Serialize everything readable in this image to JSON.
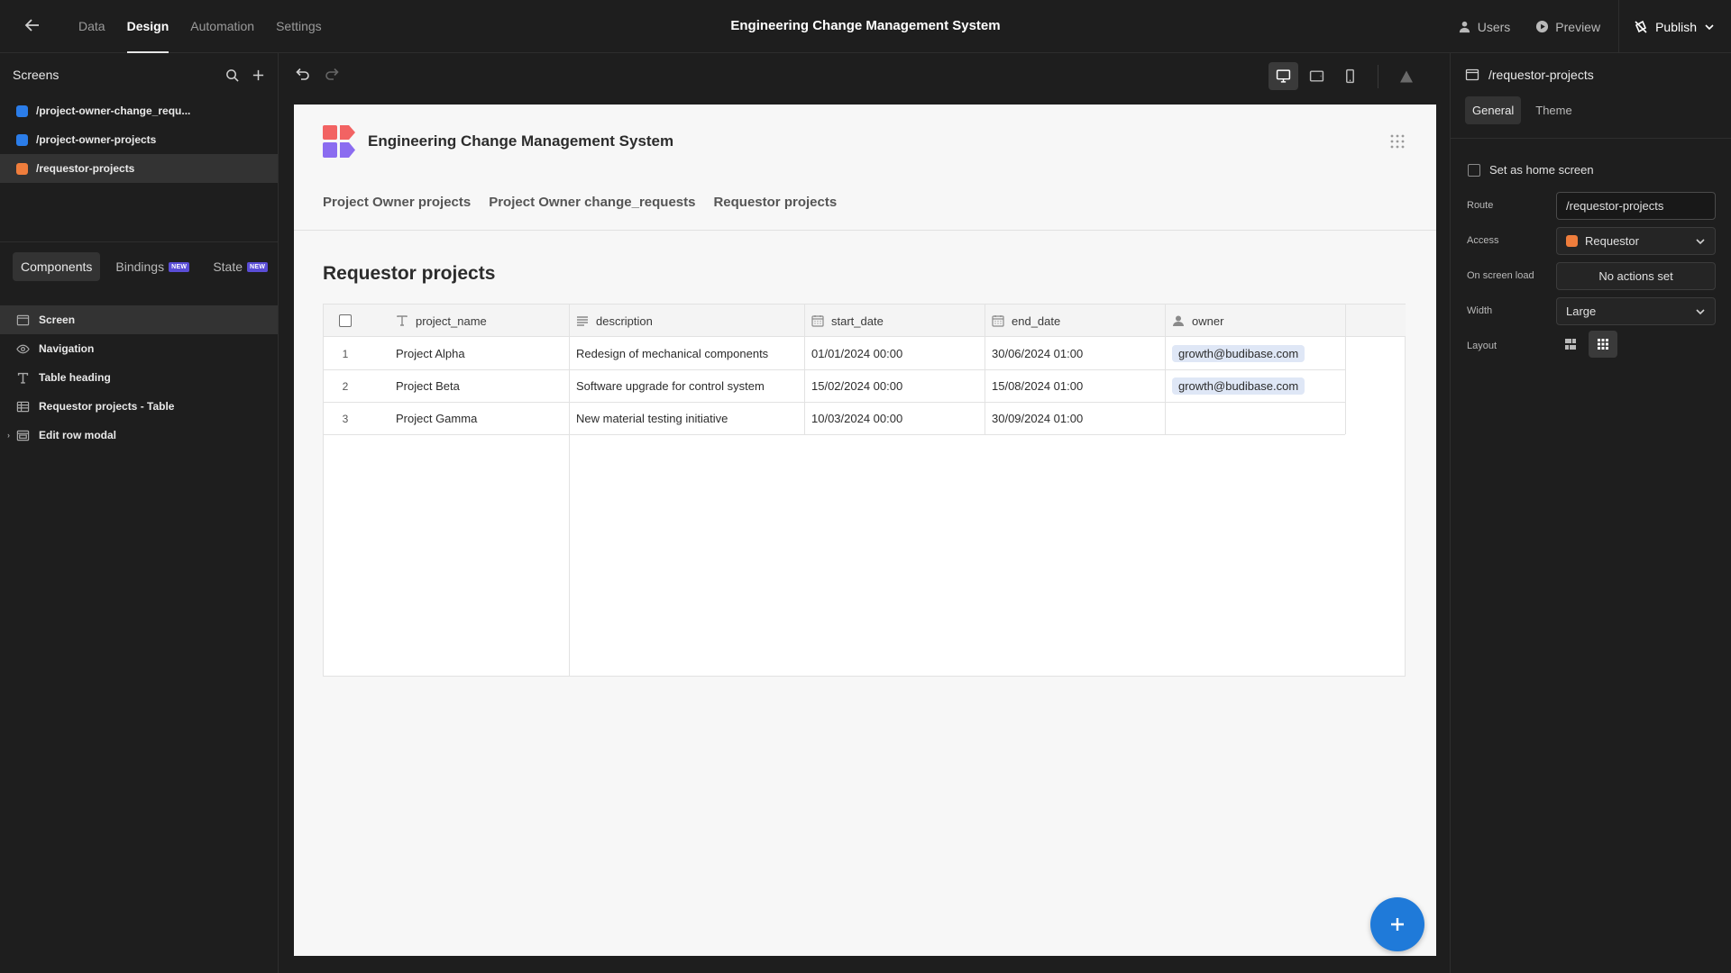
{
  "topbar": {
    "tabs": [
      {
        "label": "Data"
      },
      {
        "label": "Design"
      },
      {
        "label": "Automation"
      },
      {
        "label": "Settings"
      }
    ],
    "app_title": "Engineering Change Management System",
    "users_label": "Users",
    "preview_label": "Preview",
    "publish_label": "Publish"
  },
  "screens": {
    "title": "Screens",
    "items": [
      {
        "label": "/project-owner-change_requ...",
        "color": "#2b7de9"
      },
      {
        "label": "/project-owner-projects",
        "color": "#2b7de9"
      },
      {
        "label": "/requestor-projects",
        "color": "#ef7d3c"
      }
    ]
  },
  "component_tabs": {
    "components": "Components",
    "bindings": "Bindings",
    "state": "State",
    "new_badge": "NEW"
  },
  "tree": {
    "items": [
      {
        "label": "Screen",
        "icon": "screen-icon"
      },
      {
        "label": "Navigation",
        "icon": "eye-icon"
      },
      {
        "label": "Table heading",
        "icon": "text-icon"
      },
      {
        "label": "Requestor projects - Table",
        "icon": "table-icon"
      },
      {
        "label": "Edit row modal",
        "icon": "modal-icon"
      }
    ]
  },
  "canvas": {
    "app_title": "Engineering Change Management System",
    "nav": [
      "Project Owner projects",
      "Project Owner change_requests",
      "Requestor projects"
    ],
    "heading": "Requestor projects"
  },
  "table": {
    "columns": [
      {
        "label": "project_name",
        "icon": "text-type-icon"
      },
      {
        "label": "description",
        "icon": "paragraph-icon"
      },
      {
        "label": "start_date",
        "icon": "calendar-icon"
      },
      {
        "label": "end_date",
        "icon": "calendar-icon"
      },
      {
        "label": "owner",
        "icon": "user-icon"
      }
    ],
    "rows": [
      {
        "index": "1",
        "project_name": "Project Alpha",
        "description": "Redesign of mechanical components",
        "start_date": "01/01/2024 00:00",
        "end_date": "30/06/2024 01:00",
        "owner": "growth@budibase.com"
      },
      {
        "index": "2",
        "project_name": "Project Beta",
        "description": "Software upgrade for control system",
        "start_date": "15/02/2024 00:00",
        "end_date": "15/08/2024 01:00",
        "owner": "growth@budibase.com"
      },
      {
        "index": "3",
        "project_name": "Project Gamma",
        "description": "New material testing initiative",
        "start_date": "10/03/2024 00:00",
        "end_date": "30/09/2024 01:00",
        "owner": ""
      }
    ]
  },
  "right_panel": {
    "screen_route": "/requestor-projects",
    "tabs": {
      "general": "General",
      "theme": "Theme"
    },
    "home_screen_label": "Set as home screen",
    "route_label": "Route",
    "route_value": "/requestor-projects",
    "access_label": "Access",
    "access_value": "Requestor",
    "access_color": "#ef7d3c",
    "on_load_label": "On screen load",
    "on_load_value": "No actions set",
    "width_label": "Width",
    "width_value": "Large",
    "layout_label": "Layout"
  },
  "colors": {
    "accent_blue": "#1f7ad9",
    "owner_pill": "#dfe7f6",
    "logo_red": "#f26363",
    "logo_purple": "#8b6cf0"
  }
}
